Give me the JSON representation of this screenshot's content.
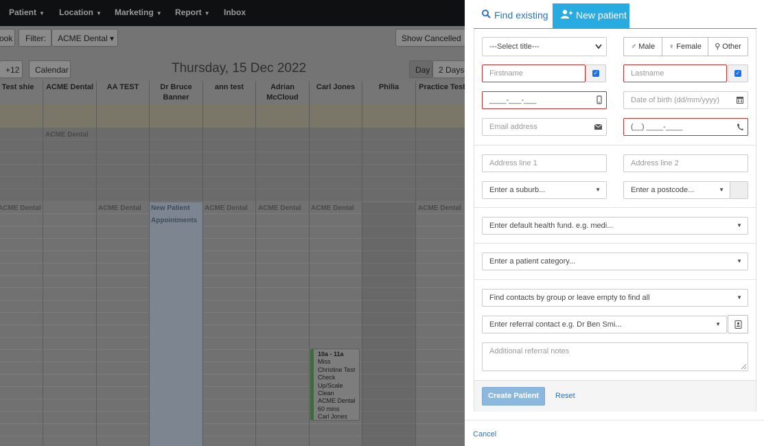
{
  "nav": {
    "items": [
      {
        "label": "Patient",
        "caret": "▼"
      },
      {
        "label": "Location",
        "caret": "▼"
      },
      {
        "label": "Marketing",
        "caret": "▼"
      },
      {
        "label": "Report",
        "caret": "▼"
      },
      {
        "label": "Inbox",
        "caret": ""
      }
    ]
  },
  "toolbar": {
    "book_label": "ook",
    "filter_label": "Filter:",
    "filter_value": "ACME Dental ▾",
    "show_cancelled": "Show Cancelled",
    "plus12": "+12",
    "calendar": "Calendar",
    "date": "Thursday, 15 Dec 2022",
    "view_day": "Day",
    "view_2days": "2 Days"
  },
  "calendar": {
    "columns": [
      {
        "name": "Test shie"
      },
      {
        "name": "ACME Dental"
      },
      {
        "name": "AA TEST"
      },
      {
        "name": "Dr Bruce Banner"
      },
      {
        "name": "ann test"
      },
      {
        "name": "Adrian McCloud"
      },
      {
        "name": "Carl Jones"
      },
      {
        "name": "Philia"
      },
      {
        "name": "Practice Test"
      }
    ],
    "location_labels": [
      "ACME Dental",
      "ACME Dental",
      "ACME Dental",
      "New Patient",
      "Appointments",
      "ACME Dental",
      "ACME Dental",
      "ACME Dental",
      "ACME Dental"
    ],
    "appointment": {
      "time": "10a - 11a",
      "lines": [
        "Miss",
        "Christine Test",
        "Check",
        "Up/Scale",
        "Clean",
        "ACME Dental",
        "60 mins",
        "Carl Jones"
      ]
    }
  },
  "modal": {
    "tabs": {
      "find_existing": "Find existing",
      "new_patient": "New patient"
    },
    "title_select": "---Select title---",
    "gender": {
      "male": "♂ Male",
      "female": "♀ Female",
      "other": "⚲ Other"
    },
    "firstname_placeholder": "Firstname",
    "lastname_placeholder": "Lastname",
    "mobile_mask": "____-___-___",
    "dob_placeholder": "Date of birth (dd/mm/yyyy)",
    "email_placeholder": "Email address",
    "phone_mask": "(__) ____-____",
    "address1_placeholder": "Address line 1",
    "address2_placeholder": "Address line 2",
    "suburb_placeholder": "Enter a suburb...",
    "postcode_placeholder": "Enter a postcode...",
    "health_fund_placeholder": "Enter default health fund. e.g. medi...",
    "category_placeholder": "Enter a patient category...",
    "contacts_group_placeholder": "Find contacts by group or leave empty to find all",
    "referral_contact_placeholder": "Enter referral contact e.g. Dr Ben Smi...",
    "referral_notes_placeholder": "Additional referral notes",
    "create_button": "Create Patient",
    "reset_button": "Reset",
    "cancel_link": "Cancel"
  },
  "icons": {
    "search": "search-icon",
    "user_plus": "user-plus-icon",
    "mobile": "mobile-icon",
    "calendar": "calendar-icon",
    "envelope": "envelope-icon",
    "phone": "phone-icon",
    "address_book": "address-book-icon"
  },
  "colors": {
    "accent": "#29aae1",
    "required_border": "#c9302c",
    "link": "#2a73b8",
    "create_button": "#8db8de"
  }
}
